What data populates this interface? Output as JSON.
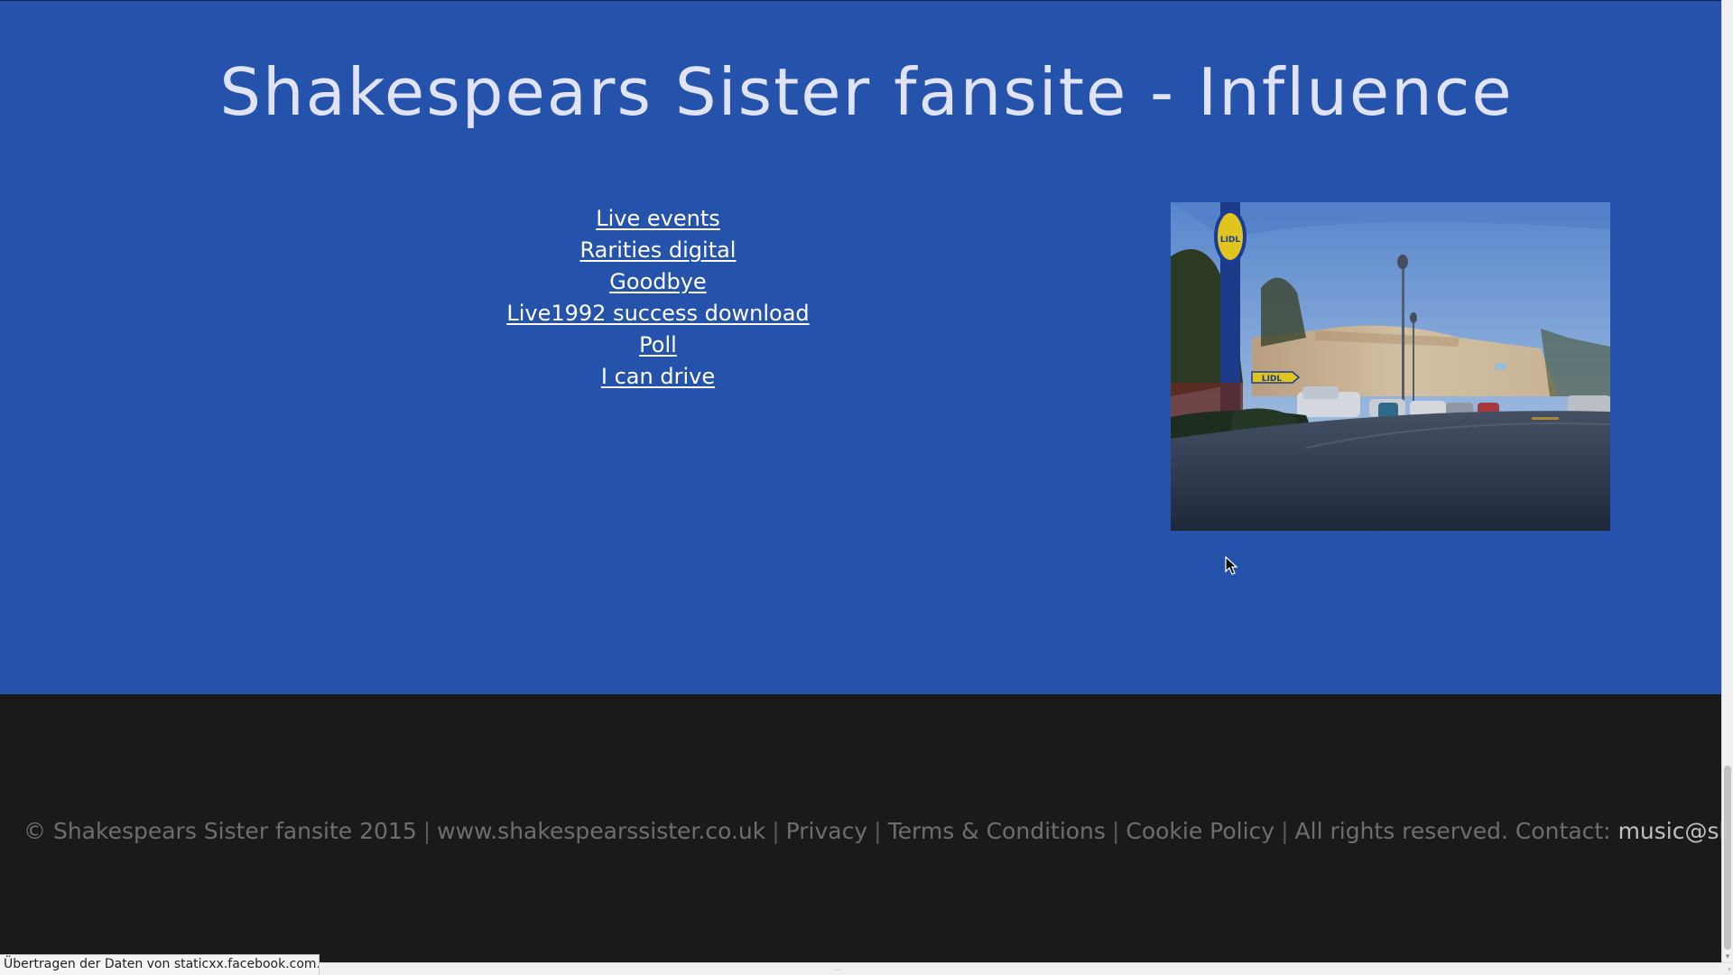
{
  "page": {
    "title": "Shakespears Sister fansite - Influence"
  },
  "nav": {
    "links": [
      "Live events",
      "Rarities digital",
      "Goodbye",
      "Live1992 success download",
      "Poll",
      "I can drive"
    ]
  },
  "photo": {
    "signs": {
      "pole_sign": "LIDL",
      "arrow_sign": "LIDL"
    }
  },
  "footer": {
    "copyright": "© Shakespears Sister fansite 2015",
    "site_url": "www.shakespearssister.co.uk",
    "privacy": "Privacy",
    "terms": "Terms & Conditions",
    "cookie": "Cookie Policy",
    "rights": "All rights reserved. Contact:",
    "email": "music@shakespearssister.co.uk",
    "separator": "|"
  },
  "status_bar": {
    "text": "Übertragen der Daten von staticxx.facebook.com..."
  },
  "colors": {
    "main_bg": "#2553ab",
    "footer_bg": "#1a1a1a",
    "title": "#dfe3f5",
    "link": "#ffffff",
    "footer_text": "#6e6e6e"
  }
}
